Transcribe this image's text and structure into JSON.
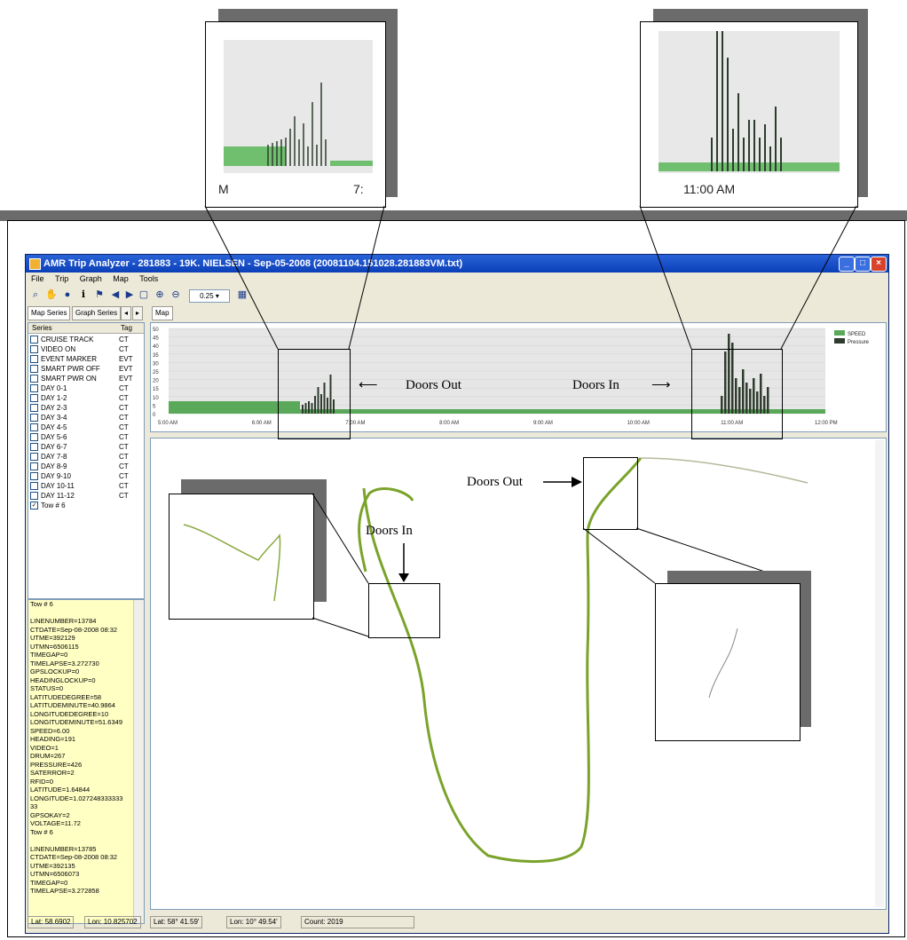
{
  "window": {
    "title": "AMR Trip Analyzer - 281883 - 19K. NIELSEN - Sep-05-2008 (20081104.151028.281883VM.txt)",
    "minimize": "_",
    "maximize": "□",
    "close": "×"
  },
  "menu": [
    "File",
    "Trip",
    "Graph",
    "Map",
    "Tools"
  ],
  "toolbar": {
    "zoom_value": "0.25"
  },
  "tabs": {
    "map_series": "Map Series",
    "graph_series": "Graph Series",
    "map": "Map"
  },
  "series_panel": {
    "col_series": "Series",
    "col_tag": "Tag",
    "items": [
      {
        "label": "CRUISE TRACK",
        "tag": "CT",
        "checked": false
      },
      {
        "label": "VIDEO ON",
        "tag": "CT",
        "checked": false
      },
      {
        "label": "EVENT MARKER",
        "tag": "EVT",
        "checked": false
      },
      {
        "label": "SMART PWR OFF",
        "tag": "EVT",
        "checked": false
      },
      {
        "label": "SMART PWR ON",
        "tag": "EVT",
        "checked": false
      },
      {
        "label": "DAY 0-1",
        "tag": "CT",
        "checked": false
      },
      {
        "label": "DAY 1-2",
        "tag": "CT",
        "checked": false
      },
      {
        "label": "DAY 2-3",
        "tag": "CT",
        "checked": false
      },
      {
        "label": "DAY 3-4",
        "tag": "CT",
        "checked": false
      },
      {
        "label": "DAY 4-5",
        "tag": "CT",
        "checked": false
      },
      {
        "label": "DAY 5-6",
        "tag": "CT",
        "checked": false
      },
      {
        "label": "DAY 6-7",
        "tag": "CT",
        "checked": false
      },
      {
        "label": "DAY 7-8",
        "tag": "CT",
        "checked": false
      },
      {
        "label": "DAY 8-9",
        "tag": "CT",
        "checked": false
      },
      {
        "label": "DAY 9-10",
        "tag": "CT",
        "checked": false
      },
      {
        "label": "DAY 10-11",
        "tag": "CT",
        "checked": false
      },
      {
        "label": "DAY 11-12",
        "tag": "CT",
        "checked": false
      },
      {
        "label": "Tow # 6",
        "tag": "",
        "checked": true
      }
    ]
  },
  "info_panel": {
    "lines": [
      "Tow # 6",
      "",
      "LINENUMBER=13784",
      "CTDATE=Sep-08-2008 08:32",
      "UTME=392129",
      "UTMN=6506115",
      "TIMEGAP=0",
      "TIMELAPSE=3.272730",
      "GPSLOCKUP=0",
      "HEADINGLOCKUP=0",
      "STATUS=0",
      "LATITUDEDEGREE=58",
      "LATITUDEMINUTE=40.9864",
      "LONGITUDEDEGREE=10",
      "LONGITUDEMINUTE=51.6349",
      "SPEED=6.00",
      "HEADING=191",
      "VIDEO=1",
      "DRUM=267",
      "PRESSURE=426",
      "SATERROR=2",
      "RFID=0",
      "LATITUDE=1.64844",
      "LONGITUDE=1.027248333333",
      "33",
      "GPSOKAY=2",
      "VOLTAGE=11.72",
      "Tow # 6",
      "",
      "LINENUMBER=13785",
      "CTDATE=Sep-08-2008 08:32",
      "UTME=392135",
      "UTMN=6506073",
      "TIMEGAP=0",
      "TIMELAPSE=3.272858"
    ]
  },
  "graph": {
    "y_ticks": [
      "50",
      "45",
      "40",
      "35",
      "30",
      "25",
      "20",
      "15",
      "10",
      "5",
      "0"
    ],
    "x_ticks": [
      "5:00 AM",
      "6:00 AM",
      "7:00 AM",
      "8:00 AM",
      "9:00 AM",
      "10:00 AM",
      "11:00 AM",
      "12:00 PM"
    ],
    "legend": [
      {
        "name": "SPEED",
        "color": "#5aa95a"
      },
      {
        "name": "Pressure",
        "color": "#2e3b2e"
      }
    ]
  },
  "annotations": {
    "doors_out_graph": "Doors Out",
    "doors_in_graph": "Doors In",
    "doors_out_map": "Doors Out",
    "doors_in_map": "Doors In"
  },
  "zoom_callouts": {
    "left_label_a": "M",
    "left_label_b": "7:",
    "right_label": "11:00 AM"
  },
  "statusbar": {
    "lat": "Lat: 58.6902",
    "lon": "Lon: 10.825702",
    "lat_dms": "Lat: 58° 41.59'",
    "lon_dms": "Lon: 10° 49.54'",
    "count": "Count: 2019"
  },
  "colors": {
    "speed": "#5aa95a",
    "pressure": "#2e3b2e",
    "track": "#7aa32a",
    "title_bar": "#0b3fb8"
  }
}
